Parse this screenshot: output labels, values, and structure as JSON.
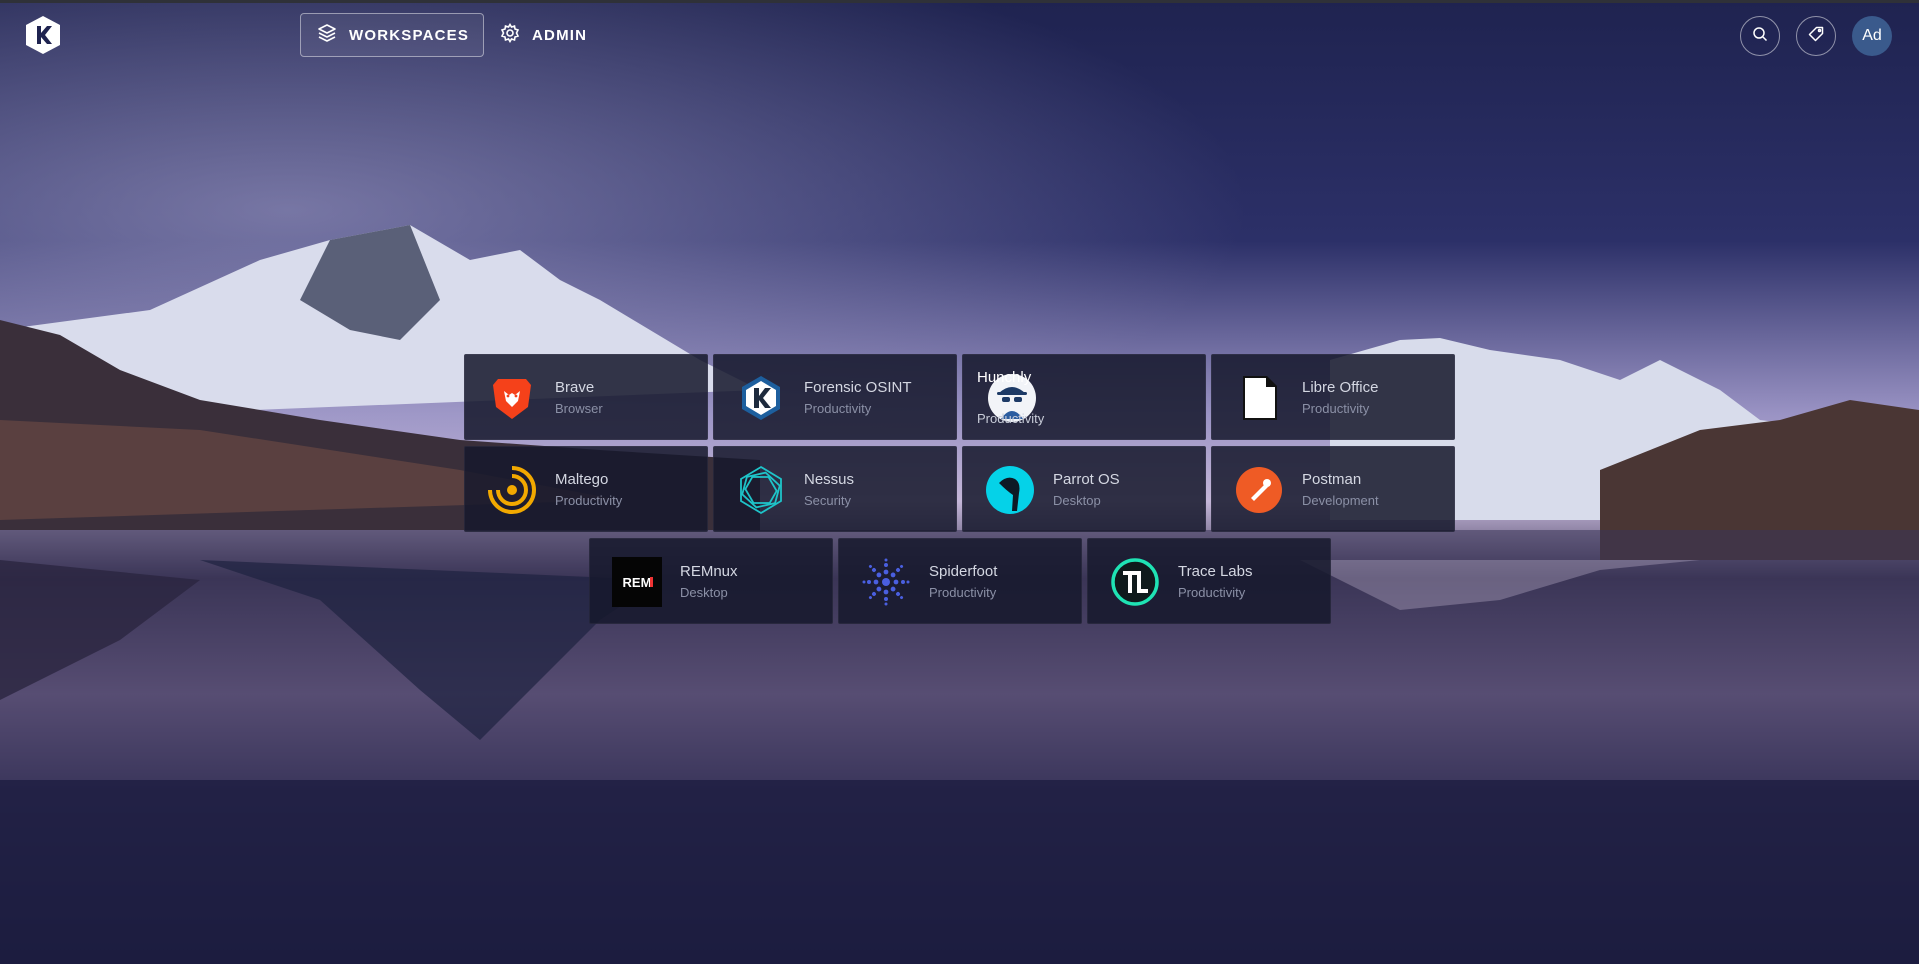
{
  "nav": {
    "workspaces_label": "WORKSPACES",
    "admin_label": "ADMIN"
  },
  "user": {
    "avatar_initials": "Ad"
  },
  "icons": {
    "logo": "kasm-logo-icon",
    "workspaces": "layers-icon",
    "admin": "gear-icon",
    "search": "search-icon",
    "tags": "tag-icon"
  },
  "colors": {
    "avatar": "#3a5a8c",
    "tile_bg": "#16182c",
    "tile_name": "#d4d7e2",
    "tile_category": "#8b90a6"
  },
  "workspaces": [
    {
      "name": "Brave",
      "category": "Browser",
      "icon": "brave-lion-icon"
    },
    {
      "name": "Forensic OSINT",
      "category": "Productivity",
      "icon": "forensic-osint-icon"
    },
    {
      "name": "Hunchly",
      "category": "Productivity",
      "icon": "hunchly-spy-icon"
    },
    {
      "name": "Libre Office",
      "category": "Productivity",
      "icon": "document-icon"
    },
    {
      "name": "Maltego",
      "category": "Productivity",
      "icon": "maltego-icon"
    },
    {
      "name": "Nessus",
      "category": "Security",
      "icon": "nessus-icon"
    },
    {
      "name": "Parrot OS",
      "category": "Desktop",
      "icon": "parrot-icon"
    },
    {
      "name": "Postman",
      "category": "Development",
      "icon": "postman-icon"
    },
    {
      "name": "REMnux",
      "category": "Desktop",
      "icon": "remnux-icon",
      "icon_text": "REM"
    },
    {
      "name": "Spiderfoot",
      "category": "Productivity",
      "icon": "spiderfoot-icon"
    },
    {
      "name": "Trace Labs",
      "category": "Productivity",
      "icon": "trace-labs-icon"
    }
  ]
}
